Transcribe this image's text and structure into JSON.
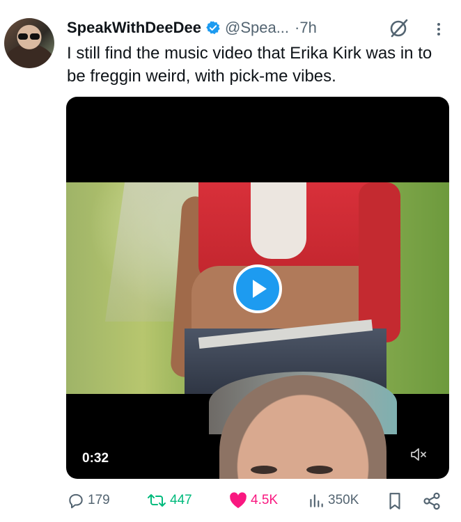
{
  "author": {
    "name": "SpeakWithDeeDee",
    "handle": "@Spea...",
    "time": "·7h"
  },
  "tweet": {
    "text": "I still find the music video that Erika Kirk was in to be freggin weird, with pick-me vibes."
  },
  "media": {
    "duration": "0:32"
  },
  "actions": {
    "replies": "179",
    "reposts": "447",
    "likes": "4.5K",
    "views": "350K"
  },
  "colors": {
    "accent": "#1d9bf0",
    "repost": "#00ba7c",
    "like": "#f91880",
    "muted": "#536471"
  },
  "icons": [
    "verified-badge-icon",
    "grok-icon",
    "more-icon",
    "play-icon",
    "mute-icon",
    "reply-icon",
    "repost-icon",
    "like-icon",
    "views-icon",
    "bookmark-icon",
    "share-icon"
  ]
}
